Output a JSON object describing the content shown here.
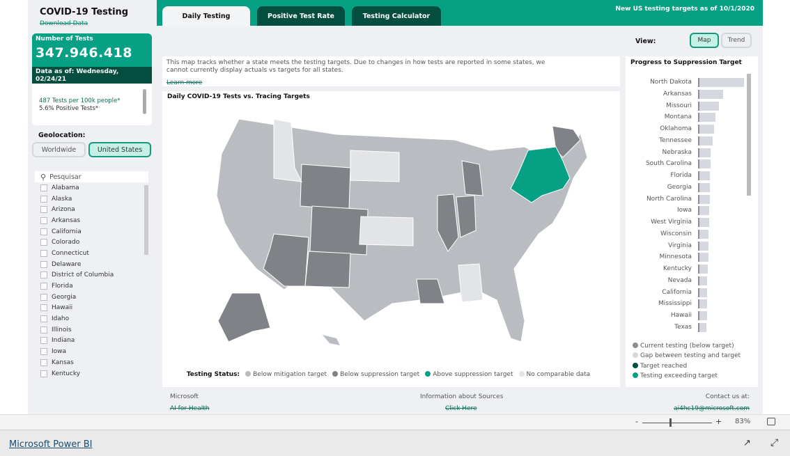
{
  "sidebar": {
    "title": "COVID-19 Testing",
    "download": "Download Data",
    "card": {
      "label": "Number of Tests",
      "value": "347.946.418",
      "date": "Data as of: Wednesday, 02/24/21",
      "line1": "487 Tests per 100k people*",
      "line2": "5.6% Positive Tests*"
    },
    "geo_label": "Geolocation:",
    "geo_options": [
      {
        "label": "Worldwide",
        "selected": false
      },
      {
        "label": "United States",
        "selected": true
      }
    ],
    "search_placeholder": "Pesquisar",
    "states": [
      "Alabama",
      "Alaska",
      "Arizona",
      "Arkansas",
      "California",
      "Colorado",
      "Connecticut",
      "Delaware",
      "District of Columbia",
      "Florida",
      "Georgia",
      "Hawaii",
      "Idaho",
      "Illinois",
      "Indiana",
      "Iowa",
      "Kansas",
      "Kentucky"
    ]
  },
  "header": {
    "tabs": [
      {
        "label": "Daily Testing",
        "active": true
      },
      {
        "label": "Positive Test Rate",
        "active": false
      },
      {
        "label": "Testing Calculator",
        "active": false
      }
    ],
    "note": "New US testing targets as of 10/1/2020"
  },
  "view": {
    "label": "View:",
    "options": [
      {
        "label": "Map",
        "selected": true
      },
      {
        "label": "Trend",
        "selected": false
      }
    ]
  },
  "description": {
    "text": "This map tracks whether a state meets the testing targets. Due to changes in how tests are reported in some states, we cannot currently display actuals vs targets for all states.",
    "link": "Learn more"
  },
  "map": {
    "title": "Daily COVID-19 Tests vs. Tracing Targets",
    "legend_title": "Testing Status:",
    "legend": [
      {
        "label": "Below mitigation target",
        "color": "#b9bcc0"
      },
      {
        "label": "Below suppression target",
        "color": "#7f8286"
      },
      {
        "label": "Above suppression target",
        "color": "#06a085"
      },
      {
        "label": "No comparable data",
        "color": "#e3e4e8"
      }
    ]
  },
  "progress": {
    "title": "Progress to Suppression Target",
    "states": [
      "North Dakota",
      "Arkansas",
      "Missouri",
      "Montana",
      "Oklahoma",
      "Tennessee",
      "Nebraska",
      "South Carolina",
      "Florida",
      "Georgia",
      "North Carolina",
      "Iowa",
      "West Virginia",
      "Wisconsin",
      "Virginia",
      "Minnesota",
      "Kentucky",
      "Nevada",
      "California",
      "Mississippi",
      "Hawaii",
      "Texas"
    ],
    "gap_relative": [
      100,
      54,
      45,
      38,
      35,
      32,
      28,
      27,
      26,
      25,
      25,
      24,
      24,
      23,
      23,
      22,
      21,
      20,
      20,
      19,
      19,
      18
    ],
    "legend": [
      {
        "label": "Current testing (below target)",
        "color": "#8a8d93"
      },
      {
        "label": "Gap between testing and target",
        "color": "#d5d8de"
      },
      {
        "label": "Target reached",
        "color": "#034e3e"
      },
      {
        "label": "Testing exceeding target",
        "color": "#06a085"
      }
    ]
  },
  "footer": {
    "left_title": "Microsoft",
    "left_link": "AI for Health",
    "mid_title": "Information about Sources",
    "mid_link": "Click Here",
    "right_title": "Contact us at:",
    "right_link": "ai4hc19@microsoft.com"
  },
  "zoom": {
    "minus": "-",
    "plus": "+",
    "value": "83%"
  },
  "powerbi": {
    "link": "Microsoft Power BI"
  },
  "colors": {
    "accent": "#06a085",
    "dark": "#034e3e"
  }
}
